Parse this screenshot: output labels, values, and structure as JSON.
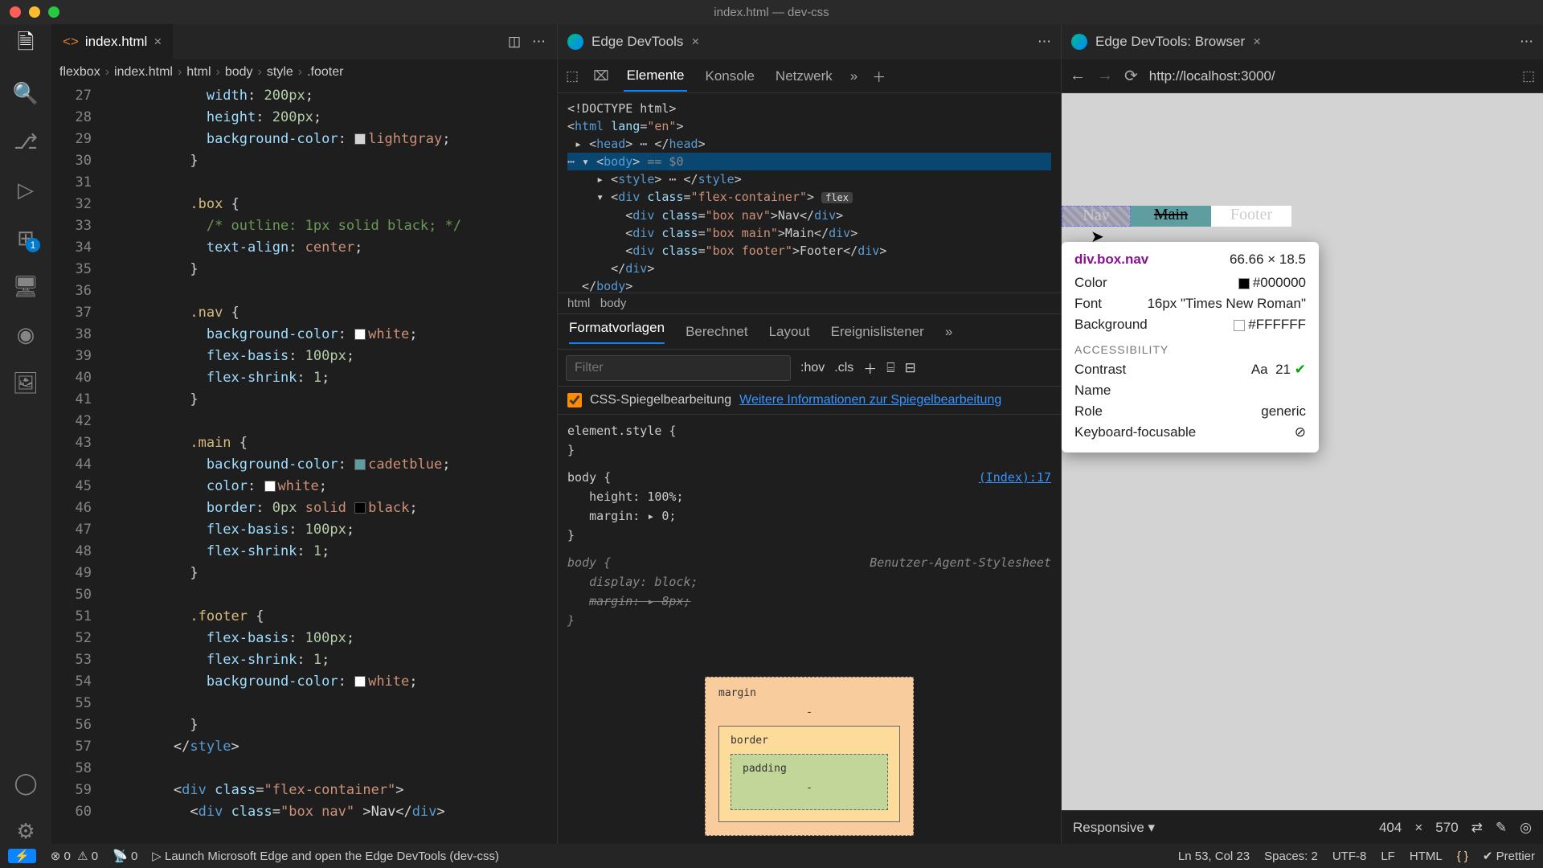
{
  "window": {
    "title": "index.html — dev-css"
  },
  "editor": {
    "tab": {
      "filename": "index.html"
    },
    "breadcrumb": [
      "flexbox",
      "index.html",
      "html",
      "body",
      "style",
      ".footer"
    ],
    "lines": [
      {
        "n": 27,
        "html": "            <span class='tok-prop'>width</span>: <span class='tok-num'>200px</span>;"
      },
      {
        "n": 28,
        "html": "            <span class='tok-prop'>height</span>: <span class='tok-num'>200px</span>;"
      },
      {
        "n": 29,
        "html": "            <span class='tok-prop'>background-color</span>: <span class='tok-swatch' style='background:lightgray'></span><span class='tok-val'>lightgray</span>;"
      },
      {
        "n": 30,
        "html": "          <span class='tok-punc'>}</span>"
      },
      {
        "n": 31,
        "html": ""
      },
      {
        "n": 32,
        "html": "          <span class='tok-sel'>.box</span> <span class='tok-punc'>{</span>"
      },
      {
        "n": 33,
        "html": "            <span class='tok-comment'>/* outline: 1px solid black; */</span>"
      },
      {
        "n": 34,
        "html": "            <span class='tok-prop'>text-align</span>: <span class='tok-val'>center</span>;"
      },
      {
        "n": 35,
        "html": "          <span class='tok-punc'>}</span>"
      },
      {
        "n": 36,
        "html": ""
      },
      {
        "n": 37,
        "html": "          <span class='tok-sel'>.nav</span> <span class='tok-punc'>{</span>"
      },
      {
        "n": 38,
        "html": "            <span class='tok-prop'>background-color</span>: <span class='tok-swatch' style='background:white'></span><span class='tok-val'>white</span>;"
      },
      {
        "n": 39,
        "html": "            <span class='tok-prop'>flex-basis</span>: <span class='tok-num'>100px</span>;"
      },
      {
        "n": 40,
        "html": "            <span class='tok-prop'>flex-shrink</span>: <span class='tok-num'>1</span>;"
      },
      {
        "n": 41,
        "html": "          <span class='tok-punc'>}</span>"
      },
      {
        "n": 42,
        "html": ""
      },
      {
        "n": 43,
        "html": "          <span class='tok-sel'>.main</span> <span class='tok-punc'>{</span>"
      },
      {
        "n": 44,
        "html": "            <span class='tok-prop'>background-color</span>: <span class='tok-swatch' style='background:cadetblue'></span><span class='tok-val'>cadetblue</span>;"
      },
      {
        "n": 45,
        "html": "            <span class='tok-prop'>color</span>: <span class='tok-swatch' style='background:white'></span><span class='tok-val'>white</span>;"
      },
      {
        "n": 46,
        "html": "            <span class='tok-prop'>border</span>: <span class='tok-num'>0px</span> <span class='tok-val'>solid</span> <span class='tok-swatch' style='background:black'></span><span class='tok-val'>black</span>;"
      },
      {
        "n": 47,
        "html": "            <span class='tok-prop'>flex-basis</span>: <span class='tok-num'>100px</span>;"
      },
      {
        "n": 48,
        "html": "            <span class='tok-prop'>flex-shrink</span>: <span class='tok-num'>1</span>;"
      },
      {
        "n": 49,
        "html": "          <span class='tok-punc'>}</span>"
      },
      {
        "n": 50,
        "html": ""
      },
      {
        "n": 51,
        "html": "          <span class='tok-sel'>.footer</span> <span class='tok-punc'>{</span>"
      },
      {
        "n": 52,
        "html": "            <span class='tok-prop'>flex-basis</span>: <span class='tok-num'>100px</span>;"
      },
      {
        "n": 53,
        "html": "            <span class='tok-prop'>flex-shrink</span>: <span class='tok-num'>1</span>;"
      },
      {
        "n": 54,
        "html": "            <span class='tok-prop'>background-color</span>: <span class='tok-swatch' style='background:white'></span><span class='tok-val'>white</span>;"
      },
      {
        "n": 55,
        "html": ""
      },
      {
        "n": 56,
        "html": "          <span class='tok-punc'>}</span>"
      },
      {
        "n": 57,
        "html": "        &lt;/<span class='tok-tag'>style</span>&gt;"
      },
      {
        "n": 58,
        "html": ""
      },
      {
        "n": 59,
        "html": "        &lt;<span class='tok-tag'>div</span> <span class='tok-attr'>class</span>=<span class='tok-str'>\"flex-container\"</span>&gt;"
      },
      {
        "n": 60,
        "html": "          &lt;<span class='tok-tag'>div</span> <span class='tok-attr'>class</span>=<span class='tok-str'>\"box nav\"</span> &gt;Nav&lt;/<span class='tok-tag'>div</span>&gt;"
      }
    ]
  },
  "devtools": {
    "tab_title": "Edge DevTools",
    "tabs": [
      "Elemente",
      "Konsole",
      "Netzwerk"
    ],
    "active_tab": "Elemente",
    "dom_breadcrumb": [
      "html",
      "body"
    ],
    "styles_tabs": [
      "Formatvorlagen",
      "Berechnet",
      "Layout",
      "Ereignislistener"
    ],
    "filter_placeholder": "Filter",
    "hov_label": ":hov",
    "cls_label": ".cls",
    "mirror_label": "CSS-Spiegelbearbeitung",
    "mirror_link": "Weitere Informationen zur Spiegelbearbeitung",
    "rules": {
      "elstyle": "element.style {",
      "body_src": "(Index):17",
      "body_rules": [
        "height: 100%;",
        "margin: ▸ 0;"
      ],
      "ua_label": "Benutzer-Agent-Stylesheet",
      "ua_rules": [
        "display: block;",
        "margin: ▸ 8px;"
      ]
    },
    "box_model": {
      "margin": "margin",
      "border": "border",
      "padding": "padding",
      "dash": "-"
    }
  },
  "browser": {
    "tab_title": "Edge DevTools: Browser",
    "url": "http://localhost:3000/",
    "preview": {
      "nav": "Nav",
      "main": "Main",
      "footer": "Footer"
    },
    "tip": {
      "selector": "div.box.nav",
      "dims": "66.66 × 18.5",
      "color_label": "Color",
      "color": "#000000",
      "font_label": "Font",
      "font": "16px \"Times New Roman\"",
      "bg_label": "Background",
      "bg": "#FFFFFF",
      "a11y": "ACCESSIBILITY",
      "contrast_label": "Contrast",
      "contrast_aa": "Aa",
      "contrast": "21",
      "name_label": "Name",
      "role_label": "Role",
      "role": "generic",
      "kbd_label": "Keyboard-focusable"
    },
    "footer": {
      "mode": "Responsive",
      "w": "404",
      "x": "×",
      "h": "570"
    }
  },
  "status": {
    "remote": "⚡",
    "errors": "0",
    "warnings": "0",
    "port": "0",
    "launch": "Launch Microsoft Edge and open the Edge DevTools (dev-css)",
    "pos": "Ln 53, Col 23",
    "spaces": "Spaces: 2",
    "enc": "UTF-8",
    "eol": "LF",
    "lang": "HTML",
    "prettier": "Prettier"
  }
}
